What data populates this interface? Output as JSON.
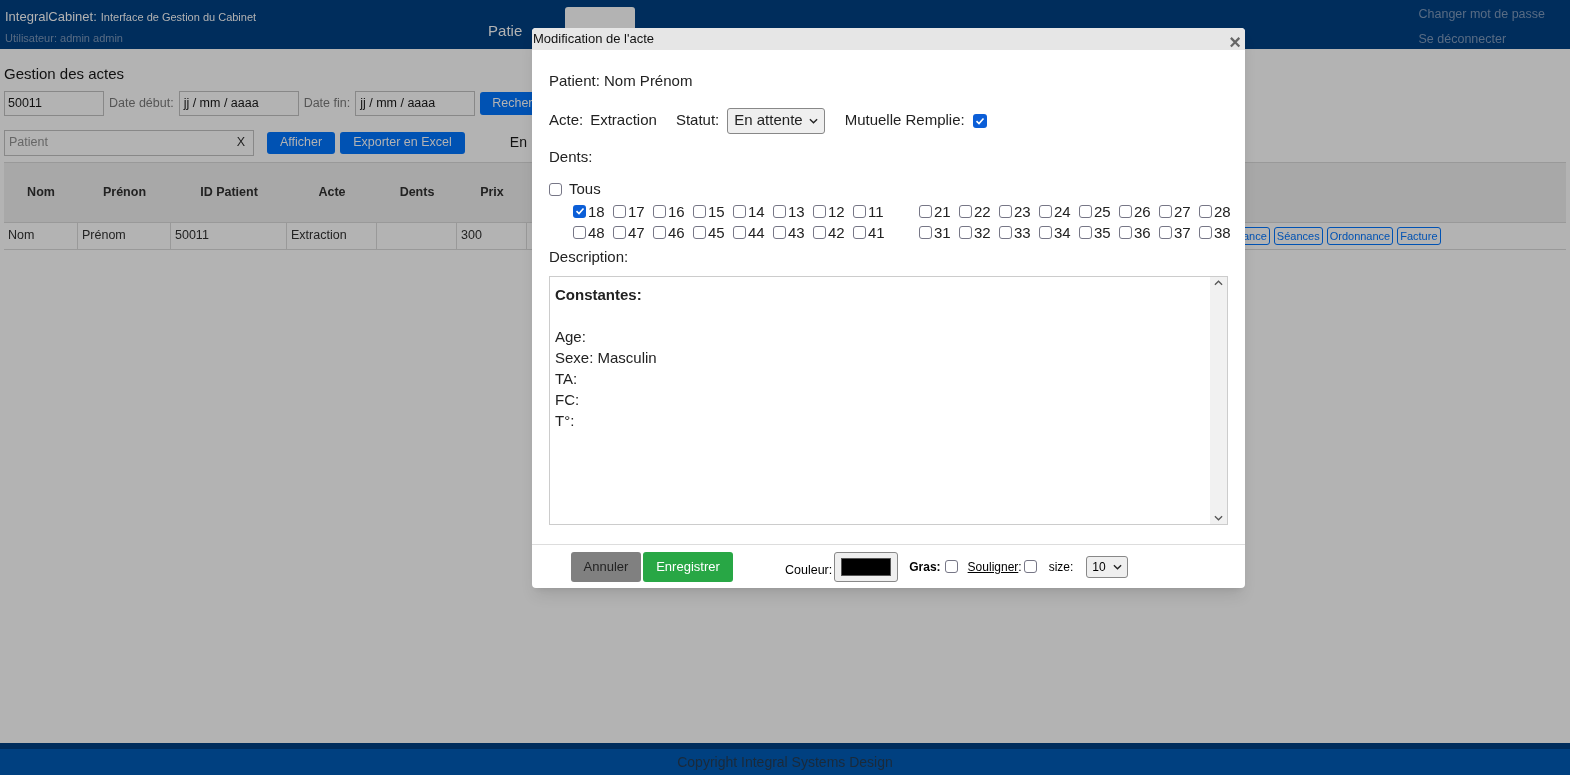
{
  "header": {
    "app_name": "IntegralCabinet:",
    "app_subtitle": "Interface de Gestion du Cabinet",
    "user": "Utilisateur: admin admin",
    "links": [
      "Changer mot de passe",
      "Se déconnecter"
    ]
  },
  "nav": [
    {
      "label": "Patie",
      "selected": false
    },
    {
      "selected": true
    }
  ],
  "page_title": "Gestion des actes",
  "filters": {
    "id_value": "50011",
    "start_label": "Date début:",
    "start_value": "jj / mm / aaaa",
    "end_label": "Date fin:",
    "end_value": "jj / mm / aaaa",
    "search_button": "Recher",
    "patient_placeholder": "Patient",
    "clear": "X",
    "show_button": "Afficher",
    "export_button": "Exporter en Excel",
    "extra_text": "En"
  },
  "table": {
    "columns": [
      "Nom",
      "Prénon",
      "ID Patient",
      "Acte",
      "Dents",
      "Prix"
    ],
    "rows": [
      {
        "cells": [
          "Nom",
          "Prénom",
          "50011",
          "Extraction",
          "",
          "300"
        ],
        "actions": [
          "ance",
          "Séances",
          "Ordonnance",
          "Facture"
        ]
      }
    ]
  },
  "modal": {
    "title": "Modification de l'acte",
    "close": "×",
    "patient": "Patient: Nom Prénom",
    "acte_label": "Acte:",
    "acte_value": "Extraction",
    "status_label": "Statut:",
    "status_value": "En attente",
    "mutuelle_label": "Mutuelle Remplie:",
    "mutuelle_checked": true,
    "teeth_label": "Dents:",
    "all_label": "Tous",
    "all_checked": false,
    "teeth_rows": [
      {
        "left": [
          {
            "label": "18",
            "checked": true
          },
          {
            "label": "17",
            "checked": false
          },
          {
            "label": "16",
            "checked": false
          },
          {
            "label": "15",
            "checked": false
          },
          {
            "label": "14",
            "checked": false
          },
          {
            "label": "13",
            "checked": false
          },
          {
            "label": "12",
            "checked": false
          },
          {
            "label": "11",
            "checked": false
          }
        ],
        "right": [
          {
            "label": "21",
            "checked": false
          },
          {
            "label": "22",
            "checked": false
          },
          {
            "label": "23",
            "checked": false
          },
          {
            "label": "24",
            "checked": false
          },
          {
            "label": "25",
            "checked": false
          },
          {
            "label": "26",
            "checked": false
          },
          {
            "label": "27",
            "checked": false
          },
          {
            "label": "28",
            "checked": false
          }
        ]
      },
      {
        "left": [
          {
            "label": "48",
            "checked": false
          },
          {
            "label": "47",
            "checked": false
          },
          {
            "label": "46",
            "checked": false
          },
          {
            "label": "45",
            "checked": false
          },
          {
            "label": "44",
            "checked": false
          },
          {
            "label": "43",
            "checked": false
          },
          {
            "label": "42",
            "checked": false
          },
          {
            "label": "41",
            "checked": false
          }
        ],
        "right": [
          {
            "label": "31",
            "checked": false
          },
          {
            "label": "32",
            "checked": false
          },
          {
            "label": "33",
            "checked": false
          },
          {
            "label": "34",
            "checked": false
          },
          {
            "label": "35",
            "checked": false
          },
          {
            "label": "36",
            "checked": false
          },
          {
            "label": "37",
            "checked": false
          },
          {
            "label": "38",
            "checked": false
          }
        ]
      }
    ],
    "description_label": "Description:",
    "description_lines": [
      "**Constantes:**",
      "Age:",
      "Sexe: Masculin",
      "TA:",
      "FC:",
      "T°:"
    ],
    "cancel_button": "Annuler",
    "save_button": "Enregistrer",
    "color_label": "Couleur:",
    "color": "#000000",
    "bold_label": "Gras:",
    "bold_checked": false,
    "underline_label": "Souligner",
    "underline_colon": ":",
    "underline_checked": false,
    "size_label": "size:",
    "size_value": "10"
  },
  "footer": "Copyright Integral Systems Design"
}
